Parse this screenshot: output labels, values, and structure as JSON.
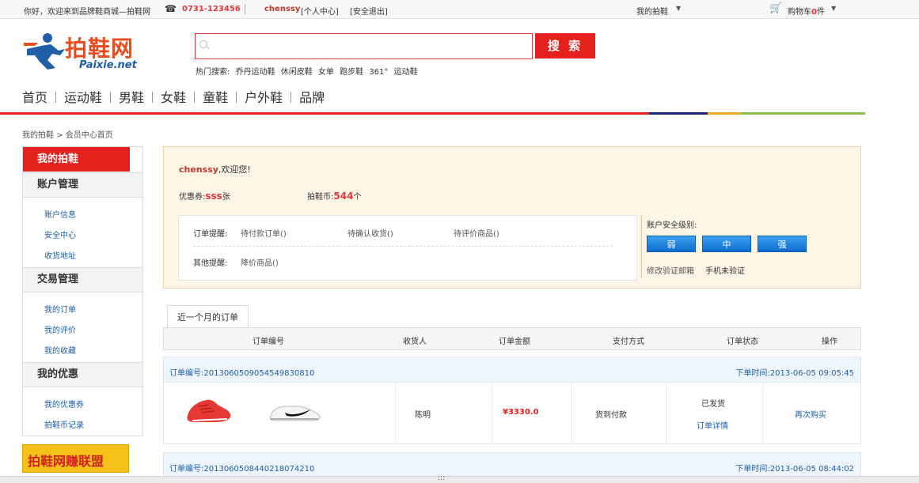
{
  "topbar": {
    "welcome": "你好，欢迎来到品牌鞋商城—拍鞋网",
    "phone": "0731-123456",
    "username": "chenssy",
    "user_center": "[个人中心]",
    "logout": "[安全退出]",
    "my_paixie": "我的拍鞋",
    "cart_prefix": "购物车",
    "cart_count": "0",
    "cart_suffix": "件"
  },
  "header": {
    "logo_cn": "拍鞋网",
    "logo_en": "Paixie.net",
    "search_placeholder": "",
    "search_button": "搜 索",
    "hot_label": "热门搜索:",
    "hot_items": [
      "乔丹运动鞋",
      "休闲皮鞋",
      "女单",
      "跑步鞋",
      "361°",
      "运动鞋"
    ]
  },
  "nav": {
    "items": [
      "首页",
      "运动鞋",
      "男鞋",
      "女鞋",
      "童鞋",
      "户外鞋",
      "品牌"
    ]
  },
  "breadcrumb": {
    "root": "我的拍鞋",
    "sep": ">",
    "current": "会员中心首页"
  },
  "sidebar": {
    "head": "我的拍鞋",
    "groups": [
      {
        "title": "账户管理",
        "links": [
          "账户信息",
          "安全中心",
          "收货地址"
        ]
      },
      {
        "title": "交易管理",
        "links": [
          "我的订单",
          "我的评价",
          "我的收藏"
        ]
      },
      {
        "title": "我的优惠",
        "links": [
          "我的优惠券",
          "拍鞋币记录"
        ]
      }
    ],
    "promo": "拍鞋网赚联盟"
  },
  "info": {
    "username": "chenssy",
    "greet_suffix": ",欢迎您!",
    "coupon_label": "优惠券:",
    "coupon_value": "sss",
    "coupon_unit": "张",
    "coin_label": "拍鞋币:",
    "coin_value": "544",
    "coin_unit": "个",
    "order_reminder_label": "订单提醒:",
    "order_reminders": [
      "待付款订单()",
      "待确认收货()",
      "待评价商品()"
    ],
    "other_reminder_label": "其他提醒:",
    "other_reminders": [
      "降价商品()"
    ],
    "security_title": "账户安全级别:",
    "security_levels": [
      "弱",
      "中",
      "强"
    ],
    "verify_email": "修改验证邮箱",
    "verify_phone": "手机未验证"
  },
  "orders": {
    "tab": "近一个月的订单",
    "columns": [
      "订单编号",
      "收货人",
      "订单金额",
      "支付方式",
      "订单状态",
      "操作"
    ],
    "list": [
      {
        "number_label": "订单编号:2013060509054549830810",
        "time_label": "下单时间:2013-06-05 09:05:45",
        "receiver": "陈明",
        "amount": "¥3330.0",
        "payment": "货到付款",
        "status": "已发货",
        "detail": "订单详情",
        "action": "再次购买"
      },
      {
        "number_label": "订单编号:2013060508440218074210",
        "time_label": "下单时间:2013-06-05 08:44:02"
      }
    ]
  },
  "colors": {
    "accent_red": "#e4211c",
    "link_blue": "#1f5fa8",
    "info_bg": "#fdf5e6",
    "level_button": "#0d6ccf"
  }
}
